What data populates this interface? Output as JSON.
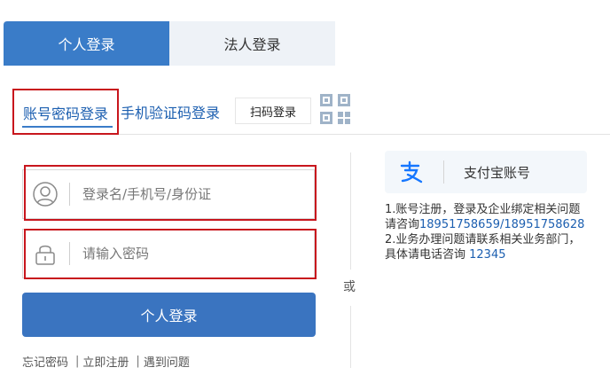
{
  "top_tabs": {
    "personal": "个人登录",
    "corporate": "法人登录"
  },
  "sub_tabs": {
    "account": "账号密码登录",
    "sms": "手机验证码登录",
    "scan": "扫码登录"
  },
  "form": {
    "username_placeholder": "登录名/手机号/身份证",
    "password_placeholder": "请输入密码",
    "login_button": "个人登录"
  },
  "links": {
    "forgot": "忘记密码",
    "register": "立即注册",
    "problem": "遇到问题",
    "separator": "|"
  },
  "divider_text": "或",
  "alipay": {
    "label": "支付宝账号"
  },
  "notice": {
    "line1": "1.账号注册，登录及企业绑定相关问题",
    "line2_prefix": "请咨询",
    "line2_phone": "18951758659/18951758628",
    "line3": "2.业务办理问题请联系相关业务部门，",
    "line4_prefix": "具体请电话咨询 ",
    "line4_phone": "12345"
  },
  "colors": {
    "primary": "#3a7cc8",
    "highlight_frame": "#c8161d",
    "link_blue": "#1c5fb0"
  },
  "icons": {
    "qr": "qr-code-icon",
    "user": "user-icon",
    "lock": "lock-icon",
    "alipay": "alipay-icon"
  }
}
